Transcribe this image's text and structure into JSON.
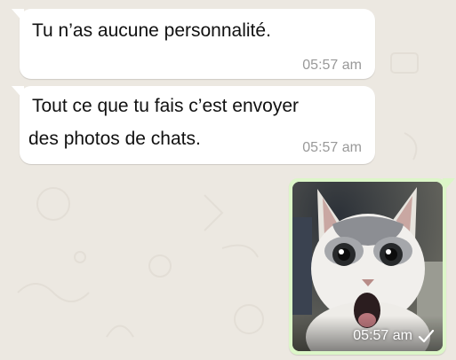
{
  "chat": {
    "messages": [
      {
        "direction": "incoming",
        "lines": [
          "Tu n’as aucune personnalité."
        ],
        "time": "05:57 am"
      },
      {
        "direction": "incoming",
        "lines": [
          "Tout ce que tu fais c’est envoyer",
          "des photos de chats."
        ],
        "time": "05:57 am"
      },
      {
        "direction": "outgoing",
        "type": "photo",
        "photo_subject": "surprised-white-cat",
        "time": "05:57 am",
        "status_icon": "single-check-icon"
      }
    ]
  },
  "colors": {
    "wallpaper": "#ece8e1",
    "incoming_bubble": "#ffffff",
    "outgoing_bubble": "#dcf6c8",
    "timestamp": "#999999"
  }
}
